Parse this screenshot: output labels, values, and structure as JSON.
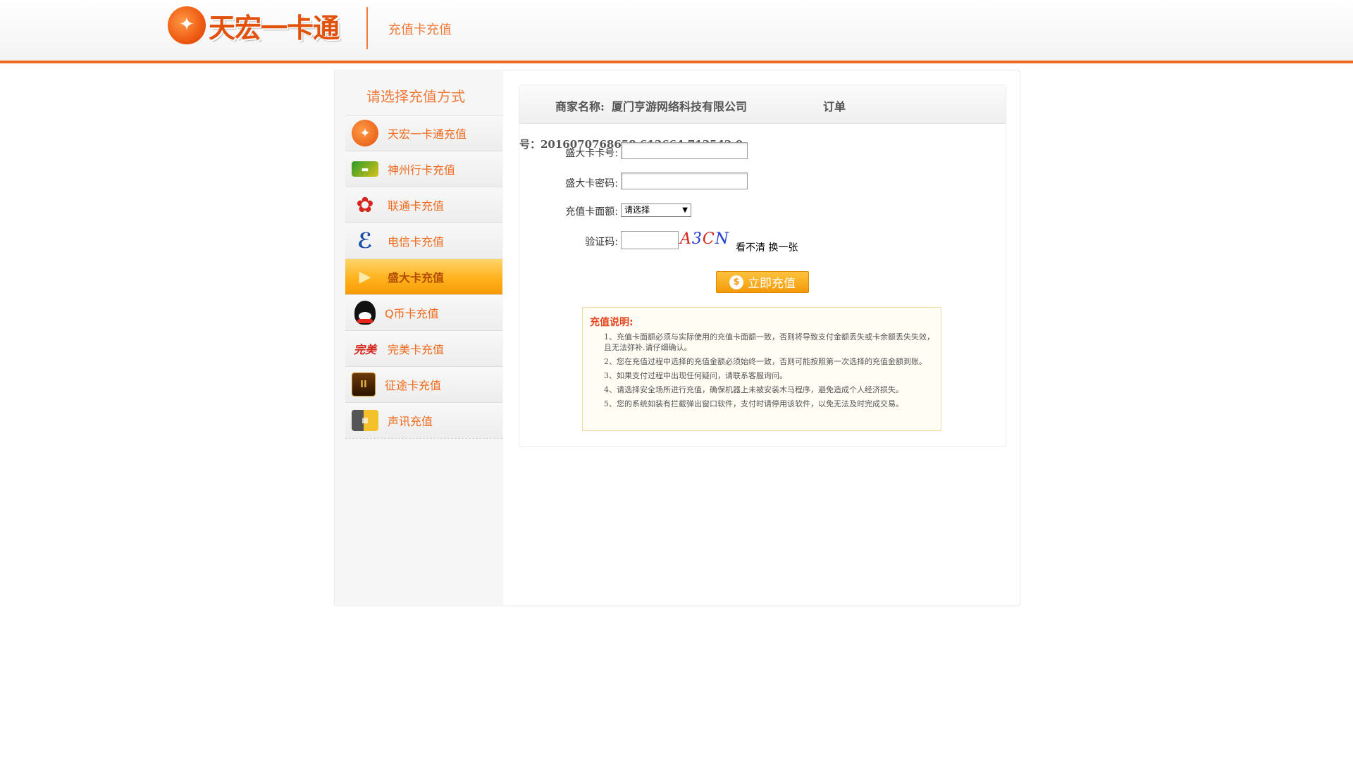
{
  "header": {
    "logo_text": "天宏一卡通",
    "subtitle": "充值卡充值"
  },
  "sidebar": {
    "title": "请选择充值方式",
    "items": [
      {
        "label": "天宏一卡通充值",
        "icon": "tianhong-logo-icon"
      },
      {
        "label": "神州行卡充值",
        "icon": "shenzhouxing-card-icon"
      },
      {
        "label": "联通卡充值",
        "icon": "china-unicom-icon"
      },
      {
        "label": "电信卡充值",
        "icon": "china-telecom-icon"
      },
      {
        "label": "盛大卡充值",
        "icon": "play-arrow-icon",
        "active": true
      },
      {
        "label": "Q币卡充值",
        "icon": "qq-penguin-icon"
      },
      {
        "label": "完美卡充值",
        "icon": "wanmei-logo-icon"
      },
      {
        "label": "征途卡充值",
        "icon": "zhengtu-logo-icon"
      },
      {
        "label": "声讯充值",
        "icon": "phone-card-icon"
      }
    ]
  },
  "panel": {
    "merchant_label": "商家名称:",
    "merchant_name": "厦门亨游网络科技有限公司",
    "order_label": "订单",
    "order_no": "号：2016070768658.613664.713542.0",
    "form": {
      "card_no_label": "盛大卡卡号:",
      "card_no_value": "",
      "card_pwd_label": "盛大卡密码:",
      "card_pwd_value": "",
      "amount_label": "充值卡面额:",
      "amount_selected": "请选择",
      "captcha_label": "验证码:",
      "captcha_value": "",
      "captcha_chars": [
        "A",
        "3",
        "C",
        "N"
      ],
      "refresh_text": "看不清 换一张",
      "submit_label": "立即充值"
    },
    "notes": {
      "title": "充值说明:",
      "items": [
        "1、充值卡面额必须与实际使用的充值卡面额一致，否则将导致支付金额丢失或卡余额丢失失效，且无法弥补.请仔细确认。",
        "2、您在充值过程中选择的充值金额必须始终一致，否则可能按照第一次选择的充值金额到账。",
        "3、如果支付过程中出现任何疑问，请联系客服询问。",
        "4、请选择安全场所进行充值，确保机器上未被安装木马程序，避免造成个人经济损失。",
        "5、您的系统如装有拦截弹出窗口软件，支付时请停用该软件，以免无法及时完成交易。"
      ]
    }
  },
  "colors": {
    "accent": "#ef6a1c",
    "active_item": "#ffb21c",
    "notes_title": "#e5451e"
  }
}
